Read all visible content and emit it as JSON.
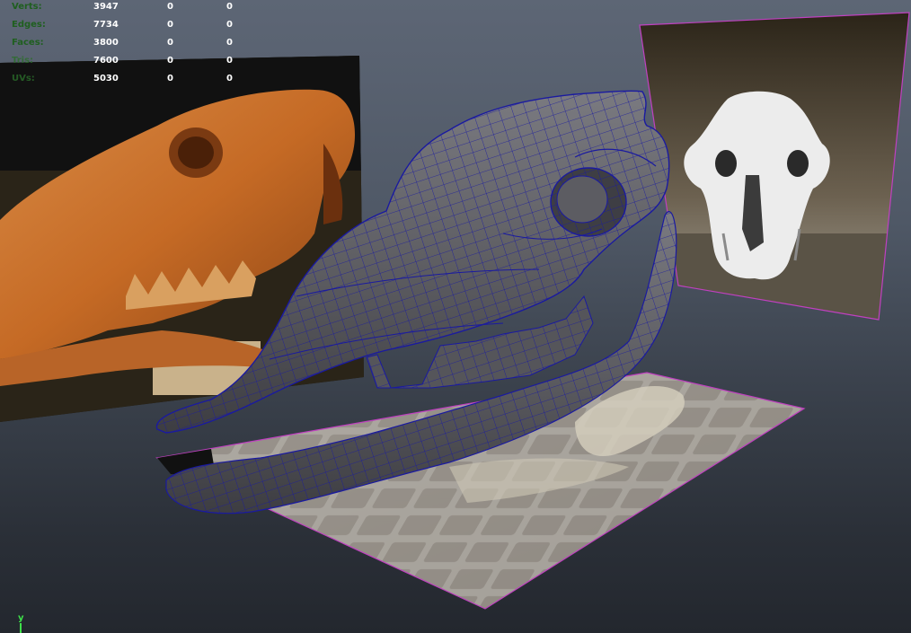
{
  "hud": {
    "rows": [
      {
        "label": "Verts:",
        "total": "3947",
        "selected": "0",
        "components": "0"
      },
      {
        "label": "Edges:",
        "total": "7734",
        "selected": "0",
        "components": "0"
      },
      {
        "label": "Faces:",
        "total": "3800",
        "selected": "0",
        "components": "0"
      },
      {
        "label": "Tris:",
        "total": "7600",
        "selected": "0",
        "components": "0"
      },
      {
        "label": "UVs:",
        "total": "5030",
        "selected": "0",
        "components": "0"
      }
    ]
  },
  "axis": {
    "label": "y"
  },
  "colors": {
    "wireframe": "#1a1aa0",
    "mesh": "#5e5e62",
    "plane_border": "#c040c0",
    "axis": "#3ee04a"
  },
  "icons": {
    "left_image_plane": "skull-side-photo",
    "right_image_plane": "skull-front-photo",
    "floor_image_plane": "skull-top-photo"
  }
}
